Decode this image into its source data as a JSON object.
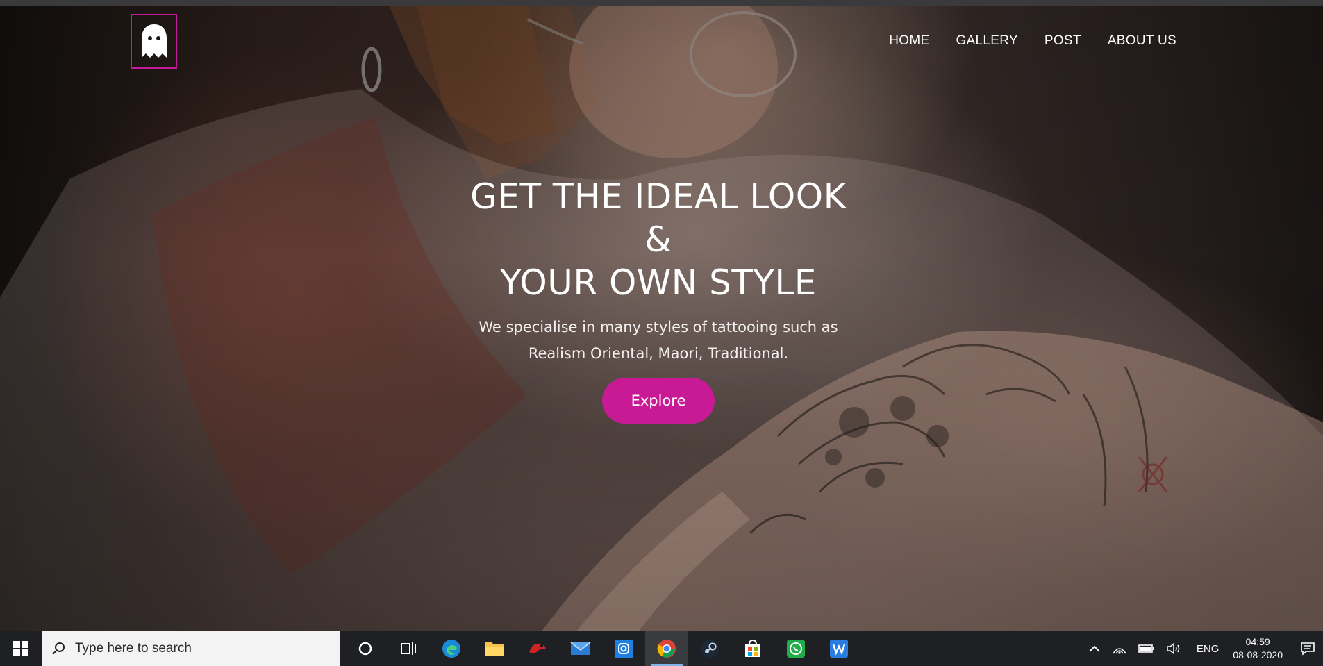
{
  "nav": {
    "items": [
      "HOME",
      "GALLERY",
      "POST",
      "ABOUT US"
    ]
  },
  "hero": {
    "headline_line1": "GET THE IDEAL LOOK",
    "headline_line2": "&",
    "headline_line3": "YOUR OWN STYLE",
    "sub_line1": "We specialise in many styles of tattooing such as",
    "sub_line2": "Realism Oriental, Maori, Traditional.",
    "cta": "Explore"
  },
  "colors": {
    "accent": "#c71a94",
    "logo_border": "#c4199b",
    "taskbar": "#1f2023"
  },
  "icons": {
    "logo": "ghost-icon",
    "taskbar": [
      "windows-start-icon",
      "search-icon",
      "cortana-icon",
      "task-view-icon",
      "edge-icon",
      "file-explorer-icon",
      "game-app-icon",
      "mail-icon",
      "instagram-icon",
      "chrome-icon",
      "steam-icon",
      "store-icon",
      "whatsapp-icon",
      "wps-icon"
    ],
    "tray": [
      "chevron-up-icon",
      "wifi-icon",
      "battery-icon",
      "volume-icon",
      "notification-icon"
    ]
  },
  "taskbar": {
    "search_placeholder": "Type here to search",
    "language": "ENG",
    "time": "04:59",
    "date": "08-08-2020"
  }
}
